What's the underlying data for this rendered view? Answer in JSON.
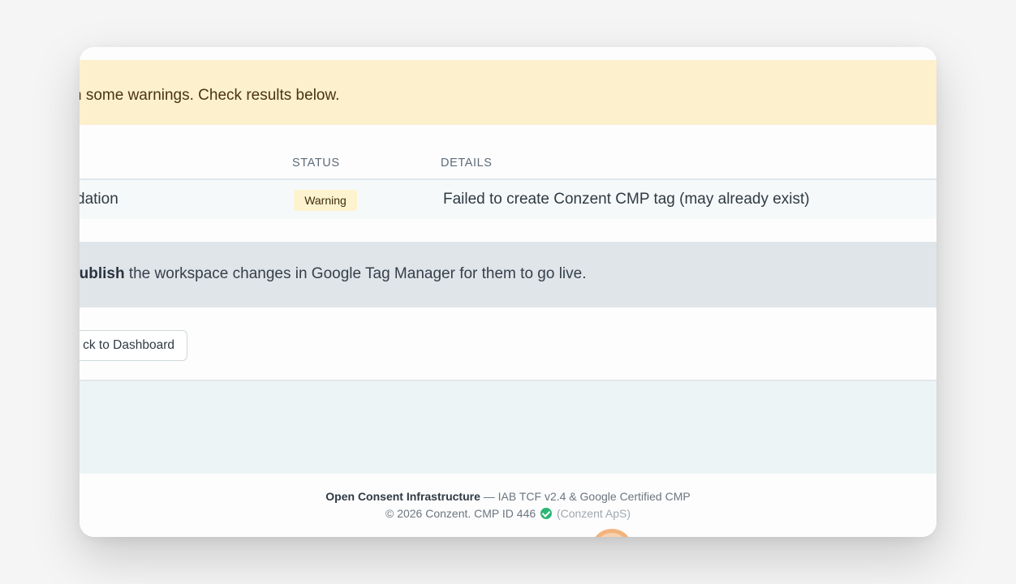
{
  "alerts": {
    "warning_text": "h some warnings. Check results below.",
    "info_bold": "publish",
    "info_text": " the workspace changes in Google Tag Manager for them to go live."
  },
  "results_table": {
    "headers": {
      "status": "STATUS",
      "details": "DETAILS"
    },
    "rows": [
      {
        "name": "dation",
        "status": "Warning",
        "details": "Failed to create Conzent CMP tag (may already exist)"
      }
    ]
  },
  "actions": {
    "back_label": "ck to Dashboard"
  },
  "footer": {
    "brand": "Open Consent Infrastructure",
    "tagline": " — IAB TCF v2.4 & Google Certified CMP",
    "copyright": "© 2026 Conzent. CMP ID 446",
    "company": "(Conzent ApS)",
    "verified_icon": "check-circle-icon"
  },
  "colors": {
    "warning_bg": "#fdf0cd",
    "info_bg": "#e0e5e9",
    "badge_bg": "#fdf3cf",
    "verified_green": "#2bb673"
  }
}
